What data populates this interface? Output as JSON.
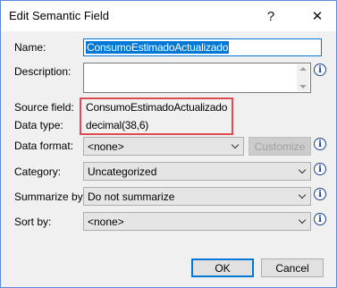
{
  "window": {
    "title": "Edit Semantic Field",
    "help_label": "?",
    "close_label": "✕"
  },
  "form": {
    "name_label": "Name:",
    "name_value": "ConsumoEstimadoActualizado",
    "description_label": "Description:",
    "description_value": "",
    "source_field_label": "Source field:",
    "source_field_value": "ConsumoEstimadoActualizado",
    "data_type_label": "Data type:",
    "data_type_value": "decimal(38,6)",
    "data_format_label": "Data format:",
    "data_format_value": "<none>",
    "customize_label": "Customize",
    "category_label": "Category:",
    "category_value": "Uncategorized",
    "summarize_label": "Summarize by:",
    "summarize_value": "Do not summarize",
    "sort_label": "Sort by:",
    "sort_value": "<none>"
  },
  "icons": {
    "info": "info-icon",
    "info_glyph": "i"
  },
  "buttons": {
    "ok": "OK",
    "cancel": "Cancel"
  },
  "colors": {
    "selection": "#0078d7",
    "highlight_box": "#e04b52",
    "dialog_background": "#f0f0f0"
  }
}
